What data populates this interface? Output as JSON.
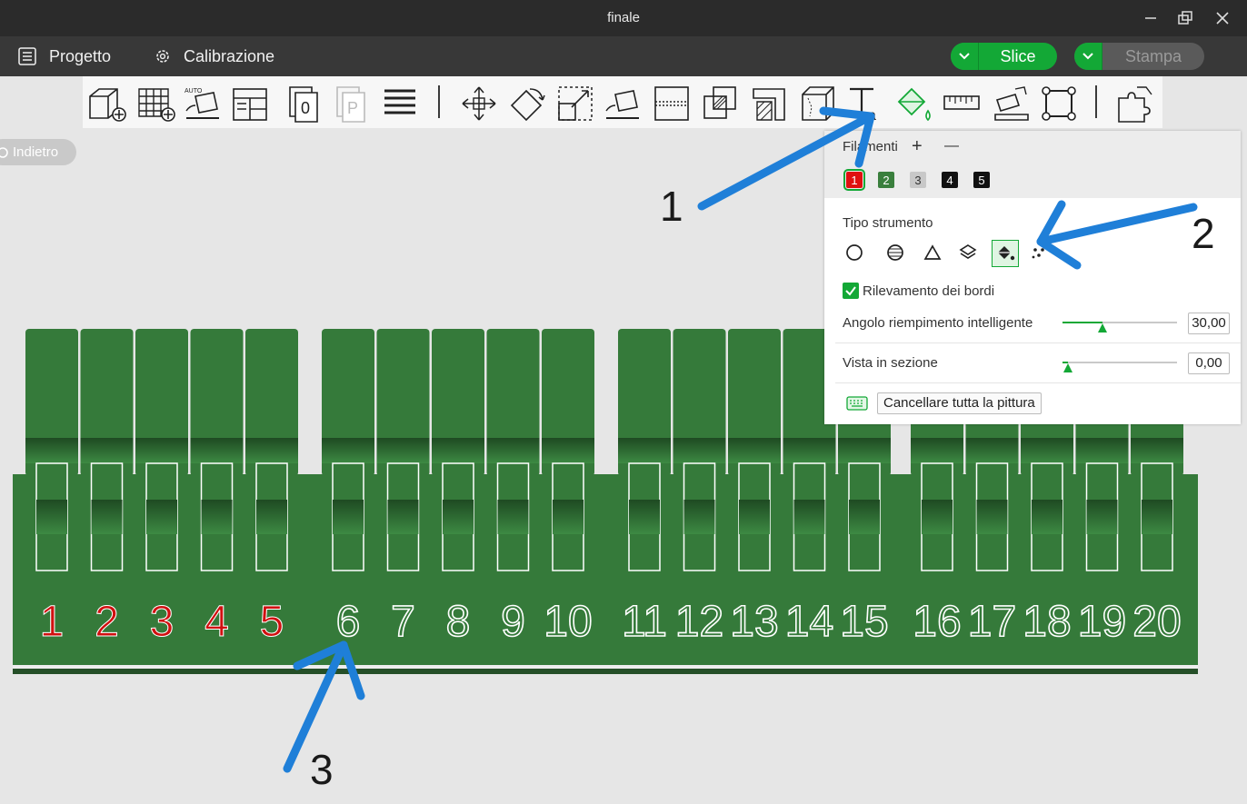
{
  "window": {
    "title": "finale"
  },
  "menu": {
    "project_label": "Progetto",
    "calibration_label": "Calibrazione",
    "slice_label": "Slice",
    "print_label": "Stampa",
    "accent_color": "#13a836"
  },
  "toolbar": {
    "icons": [
      "add-object-icon",
      "add-plate-icon",
      "auto-orient-icon",
      "arrange-icon",
      "layout-icon",
      "object-o-icon",
      "object-p-icon",
      "variable-layer-icon",
      "move-icon",
      "rotate-icon",
      "scale-icon",
      "lay-on-face-icon",
      "cut-icon",
      "boolean-icon",
      "support-paint-icon",
      "seam-paint-icon",
      "text-icon",
      "color-paint-icon",
      "measure-icon",
      "assembly-view-icon",
      "mesh-boolean-icon",
      "assembly-icon"
    ]
  },
  "back_button": {
    "label": "Indietro"
  },
  "paint_panel": {
    "filaments_label": "Filamenti",
    "add_label": "+",
    "remove_label": "—",
    "filaments": [
      {
        "label": "1",
        "color": "#e01010"
      },
      {
        "label": "2",
        "color": "#3a7f3d"
      },
      {
        "label": "3",
        "color": "#c8c8c8"
      },
      {
        "label": "4",
        "color": "#111111"
      },
      {
        "label": "5",
        "color": "#111111"
      }
    ],
    "tool_type_label": "Tipo strumento",
    "tools": [
      "circle-brush-icon",
      "sphere-brush-icon",
      "triangle-brush-icon",
      "height-range-icon",
      "fill-bucket-icon",
      "gap-fill-icon"
    ],
    "edge_detection_label": "Rilevamento dei bordi",
    "edge_detection_checked": true,
    "smart_fill_angle_label": "Angolo riempimento intelligente",
    "smart_fill_angle_value": "30,00",
    "smart_fill_angle_fraction": 0.35,
    "section_view_label": "Vista in sezione",
    "section_view_value": "0,00",
    "section_view_fraction": 0.05,
    "clear_paint_label": "Cancellare tutta la pittura"
  },
  "model": {
    "body_color": "#357a3a",
    "numbers": [
      "1",
      "2",
      "3",
      "4",
      "5",
      "6",
      "7",
      "8",
      "9",
      "10",
      "11",
      "12",
      "13",
      "14",
      "15",
      "16",
      "17",
      "18",
      "19",
      "20"
    ],
    "red_numbers_count": 5
  },
  "annotations": {
    "labels": [
      "1",
      "2",
      "3"
    ],
    "arrow_color": "#1f7fd8"
  }
}
